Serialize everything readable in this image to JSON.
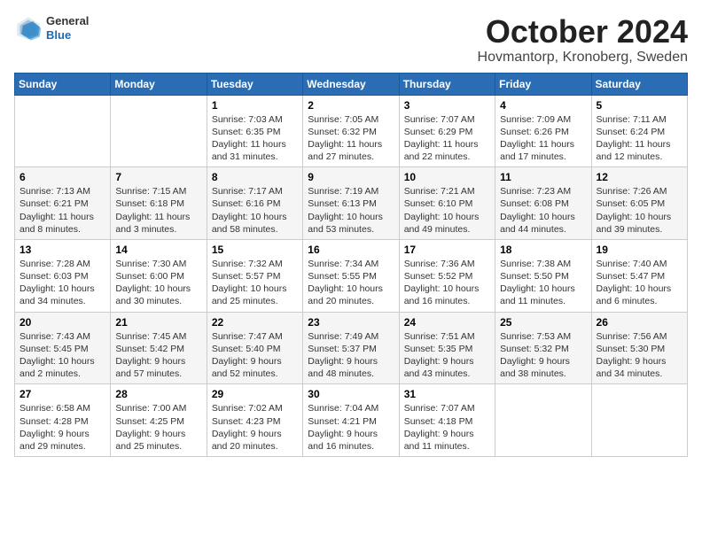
{
  "header": {
    "logo": {
      "general": "General",
      "blue": "Blue"
    },
    "title": "October 2024",
    "location": "Hovmantorp, Kronoberg, Sweden"
  },
  "days_of_week": [
    "Sunday",
    "Monday",
    "Tuesday",
    "Wednesday",
    "Thursday",
    "Friday",
    "Saturday"
  ],
  "weeks": [
    [
      {
        "day": "",
        "detail": ""
      },
      {
        "day": "",
        "detail": ""
      },
      {
        "day": "1",
        "detail": "Sunrise: 7:03 AM\nSunset: 6:35 PM\nDaylight: 11 hours and 31 minutes."
      },
      {
        "day": "2",
        "detail": "Sunrise: 7:05 AM\nSunset: 6:32 PM\nDaylight: 11 hours and 27 minutes."
      },
      {
        "day": "3",
        "detail": "Sunrise: 7:07 AM\nSunset: 6:29 PM\nDaylight: 11 hours and 22 minutes."
      },
      {
        "day": "4",
        "detail": "Sunrise: 7:09 AM\nSunset: 6:26 PM\nDaylight: 11 hours and 17 minutes."
      },
      {
        "day": "5",
        "detail": "Sunrise: 7:11 AM\nSunset: 6:24 PM\nDaylight: 11 hours and 12 minutes."
      }
    ],
    [
      {
        "day": "6",
        "detail": "Sunrise: 7:13 AM\nSunset: 6:21 PM\nDaylight: 11 hours and 8 minutes."
      },
      {
        "day": "7",
        "detail": "Sunrise: 7:15 AM\nSunset: 6:18 PM\nDaylight: 11 hours and 3 minutes."
      },
      {
        "day": "8",
        "detail": "Sunrise: 7:17 AM\nSunset: 6:16 PM\nDaylight: 10 hours and 58 minutes."
      },
      {
        "day": "9",
        "detail": "Sunrise: 7:19 AM\nSunset: 6:13 PM\nDaylight: 10 hours and 53 minutes."
      },
      {
        "day": "10",
        "detail": "Sunrise: 7:21 AM\nSunset: 6:10 PM\nDaylight: 10 hours and 49 minutes."
      },
      {
        "day": "11",
        "detail": "Sunrise: 7:23 AM\nSunset: 6:08 PM\nDaylight: 10 hours and 44 minutes."
      },
      {
        "day": "12",
        "detail": "Sunrise: 7:26 AM\nSunset: 6:05 PM\nDaylight: 10 hours and 39 minutes."
      }
    ],
    [
      {
        "day": "13",
        "detail": "Sunrise: 7:28 AM\nSunset: 6:03 PM\nDaylight: 10 hours and 34 minutes."
      },
      {
        "day": "14",
        "detail": "Sunrise: 7:30 AM\nSunset: 6:00 PM\nDaylight: 10 hours and 30 minutes."
      },
      {
        "day": "15",
        "detail": "Sunrise: 7:32 AM\nSunset: 5:57 PM\nDaylight: 10 hours and 25 minutes."
      },
      {
        "day": "16",
        "detail": "Sunrise: 7:34 AM\nSunset: 5:55 PM\nDaylight: 10 hours and 20 minutes."
      },
      {
        "day": "17",
        "detail": "Sunrise: 7:36 AM\nSunset: 5:52 PM\nDaylight: 10 hours and 16 minutes."
      },
      {
        "day": "18",
        "detail": "Sunrise: 7:38 AM\nSunset: 5:50 PM\nDaylight: 10 hours and 11 minutes."
      },
      {
        "day": "19",
        "detail": "Sunrise: 7:40 AM\nSunset: 5:47 PM\nDaylight: 10 hours and 6 minutes."
      }
    ],
    [
      {
        "day": "20",
        "detail": "Sunrise: 7:43 AM\nSunset: 5:45 PM\nDaylight: 10 hours and 2 minutes."
      },
      {
        "day": "21",
        "detail": "Sunrise: 7:45 AM\nSunset: 5:42 PM\nDaylight: 9 hours and 57 minutes."
      },
      {
        "day": "22",
        "detail": "Sunrise: 7:47 AM\nSunset: 5:40 PM\nDaylight: 9 hours and 52 minutes."
      },
      {
        "day": "23",
        "detail": "Sunrise: 7:49 AM\nSunset: 5:37 PM\nDaylight: 9 hours and 48 minutes."
      },
      {
        "day": "24",
        "detail": "Sunrise: 7:51 AM\nSunset: 5:35 PM\nDaylight: 9 hours and 43 minutes."
      },
      {
        "day": "25",
        "detail": "Sunrise: 7:53 AM\nSunset: 5:32 PM\nDaylight: 9 hours and 38 minutes."
      },
      {
        "day": "26",
        "detail": "Sunrise: 7:56 AM\nSunset: 5:30 PM\nDaylight: 9 hours and 34 minutes."
      }
    ],
    [
      {
        "day": "27",
        "detail": "Sunrise: 6:58 AM\nSunset: 4:28 PM\nDaylight: 9 hours and 29 minutes."
      },
      {
        "day": "28",
        "detail": "Sunrise: 7:00 AM\nSunset: 4:25 PM\nDaylight: 9 hours and 25 minutes."
      },
      {
        "day": "29",
        "detail": "Sunrise: 7:02 AM\nSunset: 4:23 PM\nDaylight: 9 hours and 20 minutes."
      },
      {
        "day": "30",
        "detail": "Sunrise: 7:04 AM\nSunset: 4:21 PM\nDaylight: 9 hours and 16 minutes."
      },
      {
        "day": "31",
        "detail": "Sunrise: 7:07 AM\nSunset: 4:18 PM\nDaylight: 9 hours and 11 minutes."
      },
      {
        "day": "",
        "detail": ""
      },
      {
        "day": "",
        "detail": ""
      }
    ]
  ]
}
